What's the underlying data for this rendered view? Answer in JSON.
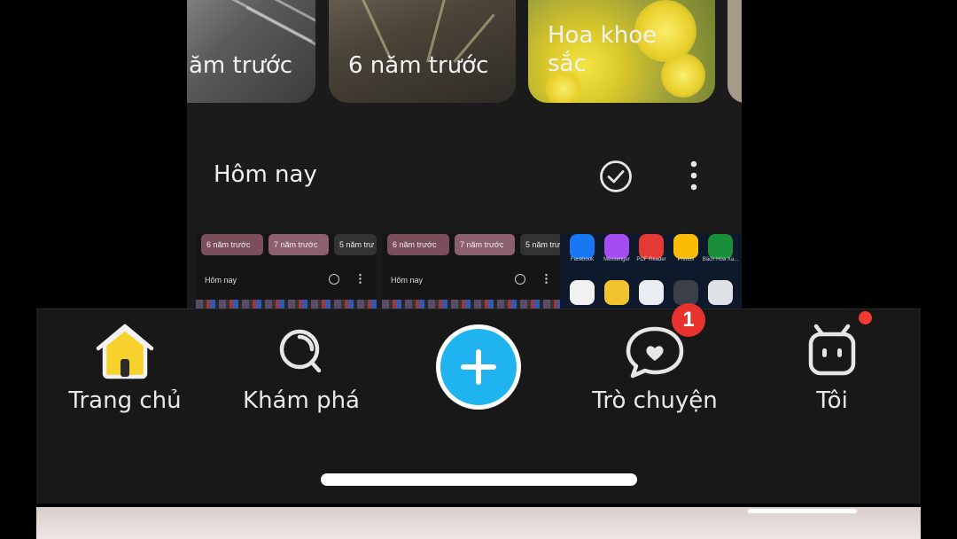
{
  "gallery": {
    "memories": [
      {
        "label": "ăm trước"
      },
      {
        "label": "6 năm trước"
      },
      {
        "label": "Hoa khoe sắc"
      }
    ],
    "section_title": "Hôm nay",
    "thumbnails": {
      "chips": [
        "6 năm trước",
        "7 năm trước",
        "5 năm trư"
      ],
      "section_title": "Hôm nay"
    },
    "apps": [
      {
        "label": "Facebook",
        "color": "#1877f2"
      },
      {
        "label": "Messenger",
        "color": "#a34df2"
      },
      {
        "label": "PDF Reader",
        "color": "#e53935"
      },
      {
        "label": "Photos",
        "color": "#fbbc04"
      },
      {
        "label": "Bách Hóa Xa...",
        "color": "#1a8f3a"
      }
    ]
  },
  "nav": {
    "home_label": "Trang chủ",
    "explore_label": "Khám phá",
    "chat_label": "Trò chuyện",
    "chat_badge": "1",
    "me_label": "Tôi"
  },
  "colors": {
    "accent": "#1fb3f0",
    "home_icon": "#f7d22c",
    "badge": "#e8322e",
    "nav_background": "#181818"
  }
}
